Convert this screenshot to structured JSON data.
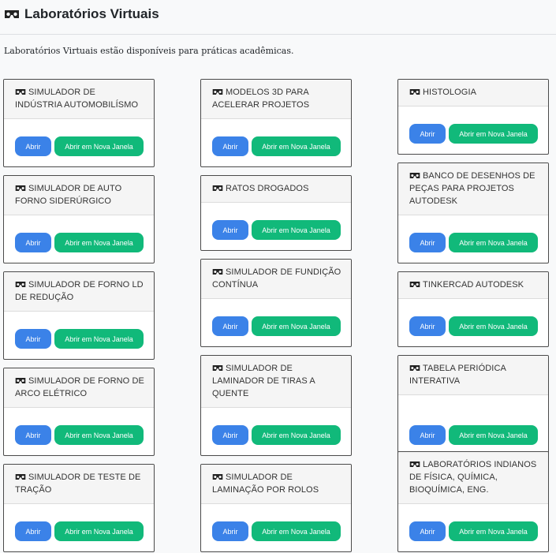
{
  "page": {
    "title": "Laboratórios Virtuais",
    "description": "Laboratórios Virtuais estão disponíveis para práticas acadêmicas.",
    "icon": "vr-goggles-icon"
  },
  "buttons": {
    "open_label": "Abrir",
    "new_window_label": "Abrir em Nova Janela"
  },
  "colors": {
    "open_button": "#3b82e8",
    "new_window_button": "#11b97a"
  },
  "columns": [
    [
      {
        "title": "SIMULADOR DE INDÚSTRIA AUTOMOBILÍSMO"
      },
      {
        "title": "SIMULADOR DE AUTO FORNO SIDERÚRGICO"
      },
      {
        "title": "SIMULADOR DE FORNO LD DE REDUÇÃO"
      },
      {
        "title": "SIMULADOR DE FORNO DE ARCO ELÉTRICO"
      },
      {
        "title": "SIMULADOR DE TESTE DE TRAÇÃO"
      }
    ],
    [
      {
        "title": "MODELOS 3D PARA ACELERAR PROJETOS"
      },
      {
        "title": "RATOS DROGADOS"
      },
      {
        "title": "SIMULADOR DE FUNDIÇÃO CONTÍNUA"
      },
      {
        "title": "SIMULADOR DE LAMINADOR DE TIRAS A QUENTE"
      },
      {
        "title": "SIMULADOR DE LAMINAÇÃO POR ROLOS"
      }
    ],
    [
      {
        "title": "HISTOLOGIA"
      },
      {
        "title": "BANCO DE DESENHOS DE PEÇAS PARA PROJETOS AUTODESK"
      },
      {
        "title": "TINKERCAD AUTODESK"
      },
      {
        "title": "TABELA PERIÓDICA INTERATIVA"
      },
      {
        "title": "LABORATÓRIOS INDIANOS DE FÍSICA, QUÍMICA, BIOQUÍMICA, ENG."
      }
    ]
  ]
}
